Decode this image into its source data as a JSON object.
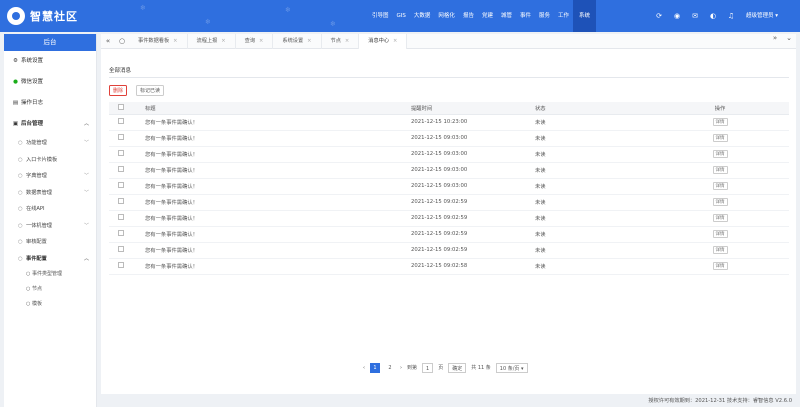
{
  "header": {
    "logo_text": "智慧社区",
    "nav": [
      "引导图",
      "GIS",
      "大数据",
      "网格化",
      "报告",
      "党建",
      "城管",
      "事件",
      "服务",
      "工作",
      "系统"
    ],
    "nav_active_index": 10,
    "user_label": "超级管理员 ▾",
    "brand_color": "#2f6fdf"
  },
  "sidebar": {
    "title": "后台",
    "items": [
      {
        "label": "系统设置",
        "icon": "gear-icon"
      },
      {
        "label": "微信设置",
        "icon": "wechat-icon"
      },
      {
        "label": "操作日志",
        "icon": "log-icon"
      },
      {
        "label": "后台管理",
        "icon": "manage-icon"
      }
    ],
    "subitems": [
      {
        "label": "功能管理"
      },
      {
        "label": "入口卡片模板"
      },
      {
        "label": "字典管理"
      },
      {
        "label": "数据表管理"
      },
      {
        "label": "在线API"
      },
      {
        "label": "一体机管理"
      },
      {
        "label": "审核配置"
      },
      {
        "label": "事件配置"
      }
    ],
    "event_subitems": [
      {
        "label": "事件类型管理"
      },
      {
        "label": "节点"
      },
      {
        "label": "模板"
      }
    ]
  },
  "tabs": [
    {
      "label": "事件数据看板"
    },
    {
      "label": "流程上报"
    },
    {
      "label": "查询"
    },
    {
      "label": "系统设置"
    },
    {
      "label": "节点"
    },
    {
      "label": "消息中心"
    }
  ],
  "message_center": {
    "tab_label": "全部消息",
    "delete_label": "删除",
    "mark_read_label": "标记已读",
    "columns": {
      "title": "标题",
      "time": "提醒时间",
      "status": "状态",
      "op": "操作"
    },
    "rows": [
      {
        "title": "您有一条事件需确认！",
        "time": "2021-12-15 10:23:00",
        "status": "未读",
        "op": "详情"
      },
      {
        "title": "您有一条事件需确认！",
        "time": "2021-12-15 09:03:00",
        "status": "未读",
        "op": "详情"
      },
      {
        "title": "您有一条事件需确认！",
        "time": "2021-12-15 09:03:00",
        "status": "未读",
        "op": "详情"
      },
      {
        "title": "您有一条事件需确认！",
        "time": "2021-12-15 09:03:00",
        "status": "未读",
        "op": "详情"
      },
      {
        "title": "您有一条事件需确认！",
        "time": "2021-12-15 09:03:00",
        "status": "未读",
        "op": "详情"
      },
      {
        "title": "您有一条事件需确认！",
        "time": "2021-12-15 09:02:59",
        "status": "未读",
        "op": "详情"
      },
      {
        "title": "您有一条事件需确认！",
        "time": "2021-12-15 09:02:59",
        "status": "未读",
        "op": "详情"
      },
      {
        "title": "您有一条事件需确认！",
        "time": "2021-12-15 09:02:59",
        "status": "未读",
        "op": "详情"
      },
      {
        "title": "您有一条事件需确认！",
        "time": "2021-12-15 09:02:59",
        "status": "未读",
        "op": "详情"
      },
      {
        "title": "您有一条事件需确认！",
        "time": "2021-12-15 09:02:58",
        "status": "未读",
        "op": "详情"
      }
    ]
  },
  "pagination": {
    "current": "1",
    "next_page": "2",
    "goto_label": "到第",
    "goto_value": "1",
    "page_unit": "页",
    "confirm_label": "确定",
    "total_label": "共 11 条",
    "page_size_label": "10 条/页 ▾"
  },
  "footer": {
    "text": "授权许可有效期到：2021-12-31  技术支持：睿智信息  V2.6.0"
  }
}
